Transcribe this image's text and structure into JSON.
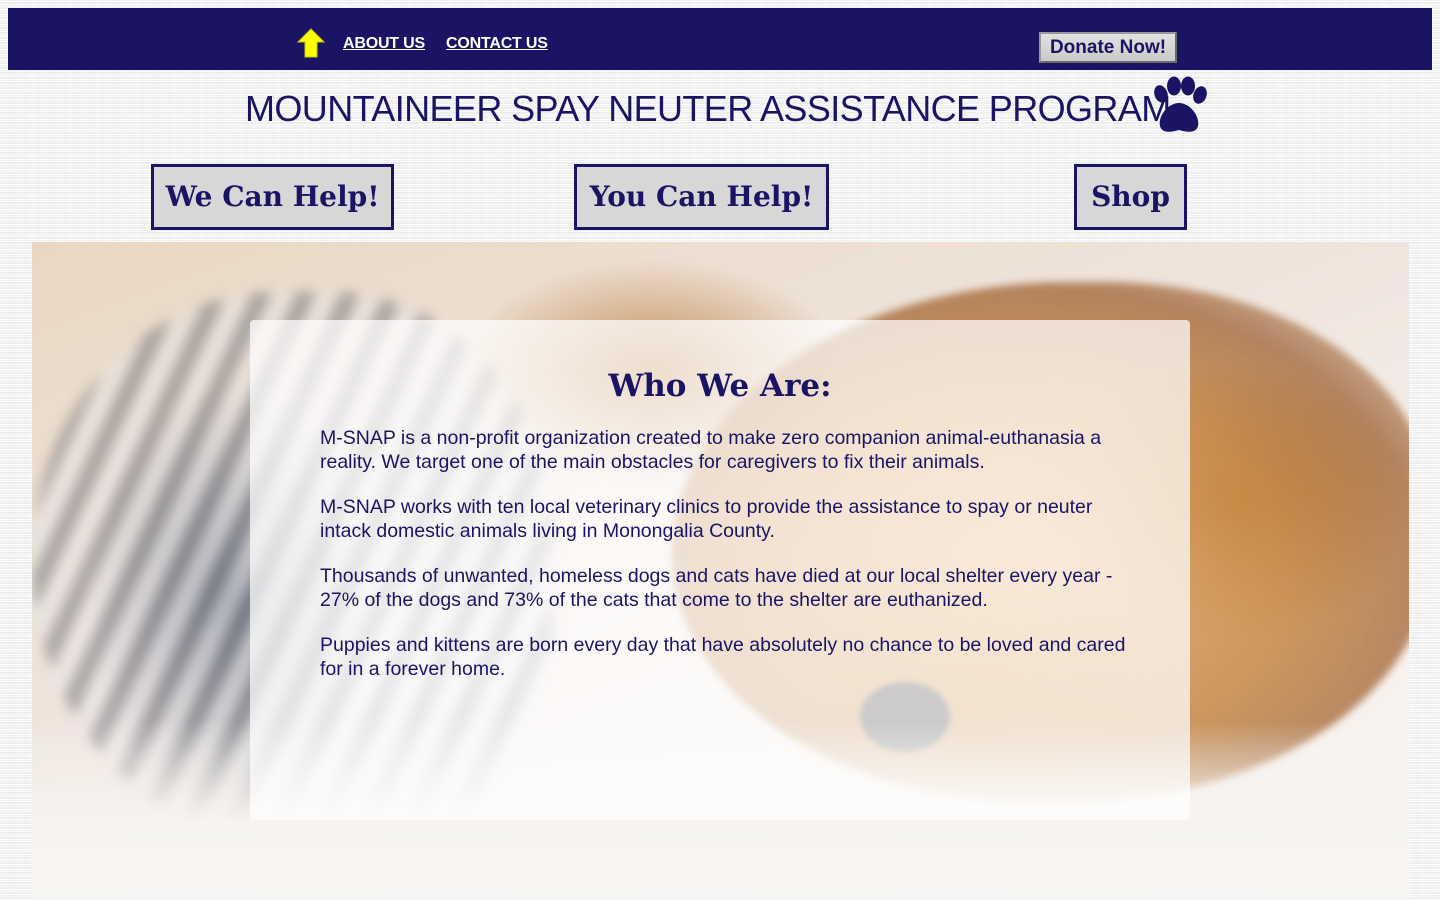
{
  "header": {
    "nav": [
      {
        "label": "ABOUT US"
      },
      {
        "label": "CONTACT US"
      }
    ],
    "donate_label": "Donate Now!"
  },
  "site": {
    "title": "MOUNTAINEER SPAY NEUTER ASSISTANCE PROGRAM"
  },
  "main_nav": [
    {
      "label": "We Can Help!"
    },
    {
      "label": "You Can Help!"
    },
    {
      "label": "Shop"
    }
  ],
  "about": {
    "heading": "Who We Are:",
    "paragraphs": [
      "M-SNAP is a non-profit organization created to make zero companion animal-euthanasia a reality. We target one of the main obstacles for caregivers to fix their animals.",
      "M-SNAP works with ten local veterinary clinics to provide the assistance to spay or neuter intack domestic animals living in Monongalia County.",
      "Thousands of unwanted, homeless dogs and cats have died at our local shelter every year - 27% of the dogs and 73% of the cats that come to the shelter are euthanized.",
      "Puppies and kittens are born every day that have absolutely no chance to be loved and cared for in a forever home."
    ]
  },
  "colors": {
    "navy": "#1b1464",
    "home_arrow": "#ffff00",
    "button_bg": "#d7d7d7"
  },
  "icons": {
    "home": "home-arrow-icon",
    "paw": "paw-icon"
  }
}
